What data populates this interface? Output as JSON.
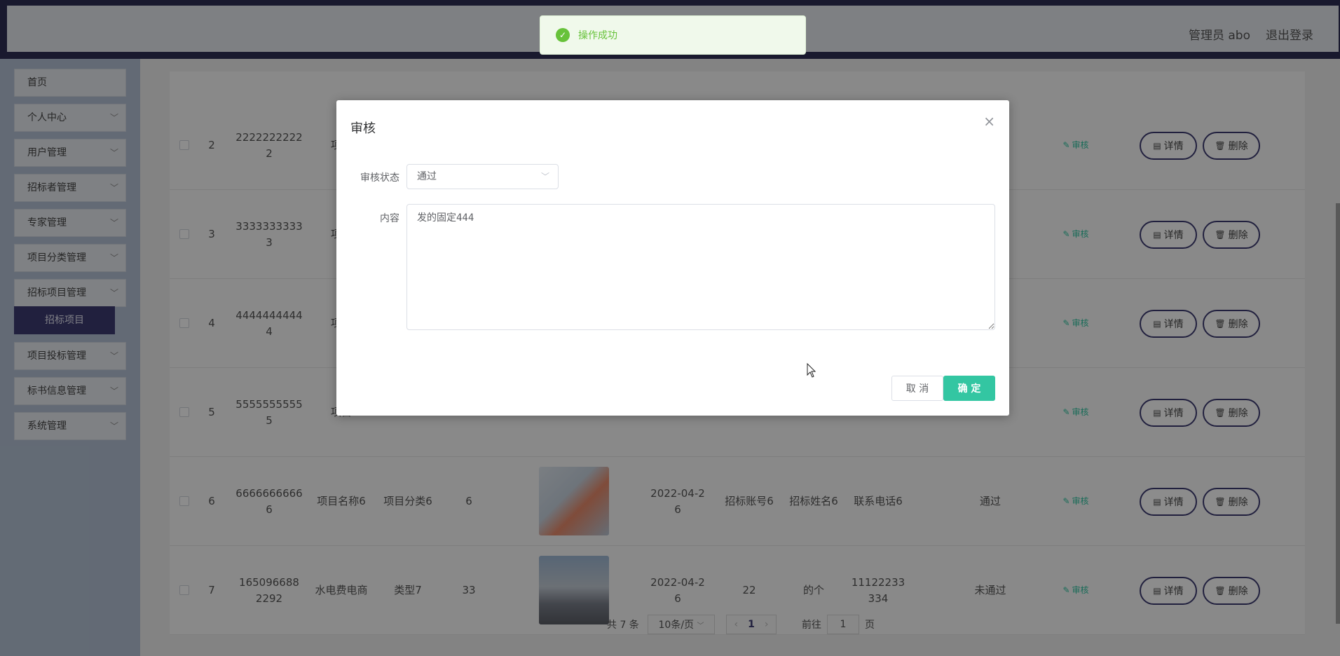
{
  "header": {
    "user_label": "管理员 abo",
    "logout_label": "退出登录"
  },
  "sidebar": {
    "items": [
      {
        "label": "首页",
        "has_chevron": false
      },
      {
        "label": "个人中心",
        "has_chevron": true
      },
      {
        "label": "用户管理",
        "has_chevron": true
      },
      {
        "label": "招标者管理",
        "has_chevron": true
      },
      {
        "label": "专家管理",
        "has_chevron": true
      },
      {
        "label": "项目分类管理",
        "has_chevron": true
      },
      {
        "label": "招标项目管理",
        "has_chevron": true
      },
      {
        "label": "项目投标管理",
        "has_chevron": true
      },
      {
        "label": "标书信息管理",
        "has_chevron": true
      },
      {
        "label": "系统管理",
        "has_chevron": true
      }
    ],
    "active_sub": "招标项目"
  },
  "table": {
    "rows": [
      {
        "index": "2",
        "number": "2222222222\n2",
        "name": "项目",
        "category": "",
        "count": "",
        "date": "",
        "account": "",
        "person": "",
        "phone": "",
        "status": ""
      },
      {
        "index": "3",
        "number": "3333333333\n3",
        "name": "项目",
        "category": "",
        "count": "",
        "date": "",
        "account": "",
        "person": "",
        "phone": "",
        "status": ""
      },
      {
        "index": "4",
        "number": "4444444444\n4",
        "name": "项目",
        "category": "",
        "count": "",
        "date": "",
        "account": "",
        "person": "",
        "phone": "",
        "status": ""
      },
      {
        "index": "5",
        "number": "5555555555\n5",
        "name": "项目",
        "category": "",
        "count": "",
        "date": "",
        "account": "",
        "person": "",
        "phone": "",
        "status": ""
      },
      {
        "index": "6",
        "number": "6666666666\n6",
        "name": "项目名称6",
        "category": "项目分类6",
        "count": "6",
        "date": "2022-04-2\n6",
        "account": "招标账号6",
        "person": "招标姓名6",
        "phone": "联系电话6",
        "status": "通过"
      },
      {
        "index": "7",
        "number": "165096688\n2292",
        "name": "水电费电商",
        "category": "类型7",
        "count": "33",
        "date": "2022-04-2\n6",
        "account": "22",
        "person": "的个",
        "phone": "11122233\n334",
        "status": "未通过"
      }
    ],
    "audit_label": "审核",
    "detail_label": "详情",
    "delete_label": "删除"
  },
  "pagination": {
    "total": "共 7 条",
    "page_size": "10条/页",
    "current_page": "1",
    "goto_label": "前往",
    "goto_value": "1",
    "page_unit": "页"
  },
  "dialog": {
    "title": "审核",
    "status_label": "审核状态",
    "status_value": "通过",
    "content_label": "内容",
    "content_value": "发的固定444",
    "cancel_label": "取 消",
    "confirm_label": "确 定"
  },
  "toast": {
    "message": "操作成功"
  }
}
